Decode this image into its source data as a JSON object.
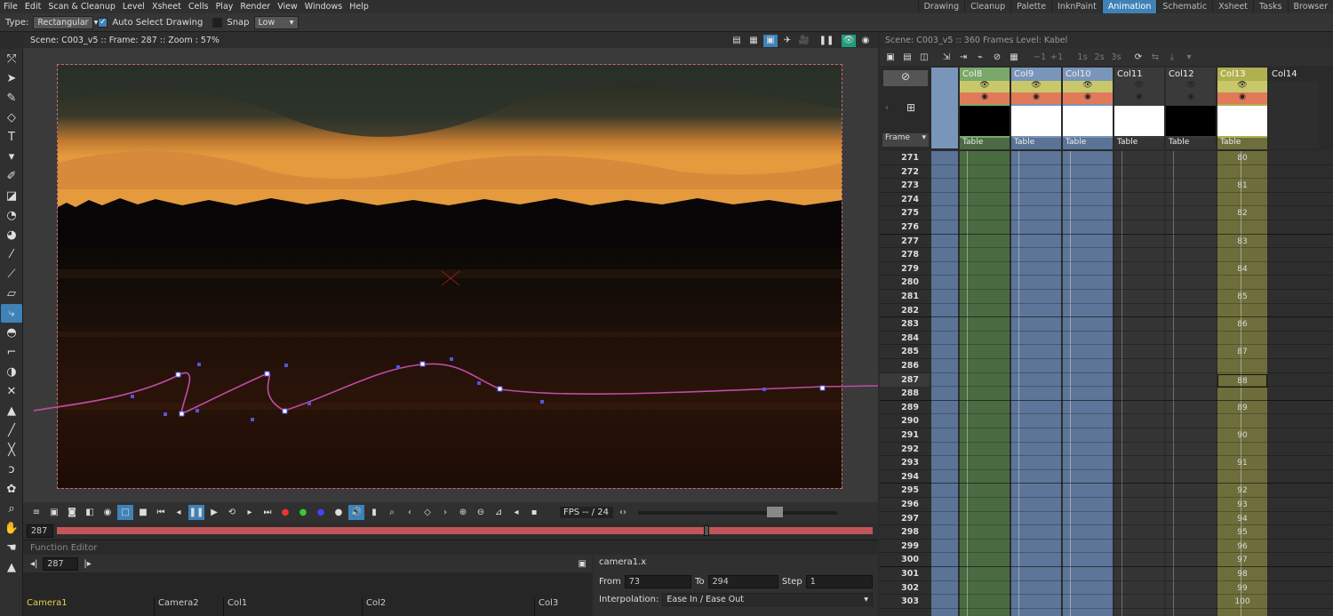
{
  "menu": [
    "File",
    "Edit",
    "Scan & Cleanup",
    "Level",
    "Xsheet",
    "Cells",
    "Play",
    "Render",
    "View",
    "Windows",
    "Help"
  ],
  "rooms": [
    "Drawing",
    "Cleanup",
    "Palette",
    "InknPaint",
    "Animation",
    "Schematic",
    "Xsheet",
    "Tasks",
    "Browser"
  ],
  "active_room": "Animation",
  "tool_options": {
    "type_label": "Type:",
    "type_value": "Rectangular",
    "auto_select_label": "Auto Select Drawing",
    "snap_label": "Snap",
    "snap_value": "Low"
  },
  "viewer": {
    "title": "Scene: C003_v5  ::  Frame: 287  ::  Zoom : 57%"
  },
  "playback": {
    "fps_label": "FPS -- / 24",
    "frame_field": "287"
  },
  "function_editor": {
    "title": "Function Editor",
    "frame_value": "287",
    "channel": "camera1.x",
    "from_label": "From",
    "from_value": "73",
    "to_label": "To",
    "to_value": "294",
    "step_label": "Step",
    "step_value": "1",
    "interp_label": "Interpolation:",
    "interp_value": "Ease In / Ease Out",
    "columns": [
      "Camera1",
      "Camera2",
      "Col1",
      "Col2",
      "Col3"
    ]
  },
  "xsheet": {
    "header": "Scene: C003_v5  ::  360 Frames  Level: Kabel",
    "frame_label": "Frame",
    "columns": [
      {
        "name": "Col8",
        "level": "Table"
      },
      {
        "name": "Col9",
        "level": "Table"
      },
      {
        "name": "Col10",
        "level": "Table"
      },
      {
        "name": "Col11",
        "level": "Table"
      },
      {
        "name": "Col12",
        "level": "Table"
      },
      {
        "name": "Col13",
        "level": "Table"
      },
      {
        "name": "Col14",
        "level": ""
      }
    ],
    "frames": [
      "271",
      "272",
      "273",
      "274",
      "275",
      "276",
      "277",
      "278",
      "279",
      "280",
      "281",
      "282",
      "283",
      "284",
      "285",
      "286",
      "287",
      "288",
      "289",
      "290",
      "291",
      "292",
      "293",
      "294",
      "295",
      "296",
      "297",
      "298",
      "299",
      "300",
      "301",
      "302",
      "303"
    ],
    "current_frame": "287",
    "col13_cells": [
      {
        "row": 0,
        "val": "80"
      },
      {
        "row": 2,
        "val": "81"
      },
      {
        "row": 4,
        "val": "82"
      },
      {
        "row": 6,
        "val": "83"
      },
      {
        "row": 8,
        "val": "84"
      },
      {
        "row": 10,
        "val": "85"
      },
      {
        "row": 12,
        "val": "86"
      },
      {
        "row": 14,
        "val": "87"
      },
      {
        "row": 16,
        "val": "88"
      },
      {
        "row": 18,
        "val": "89"
      },
      {
        "row": 20,
        "val": "90"
      },
      {
        "row": 22,
        "val": "91"
      },
      {
        "row": 24,
        "val": "92"
      },
      {
        "row": 25,
        "val": "93"
      },
      {
        "row": 26,
        "val": "94"
      },
      {
        "row": 27,
        "val": "95"
      },
      {
        "row": 28,
        "val": "96"
      },
      {
        "row": 29,
        "val": "97"
      },
      {
        "row": 30,
        "val": "98"
      },
      {
        "row": 31,
        "val": "99"
      },
      {
        "row": 32,
        "val": "100"
      }
    ]
  },
  "colors": {
    "accent": "#3e82b8",
    "col_blue": "#5a7396",
    "col_green": "#4c6a44",
    "col_olive": "#6e6e3c",
    "path": "#c04ca6"
  }
}
